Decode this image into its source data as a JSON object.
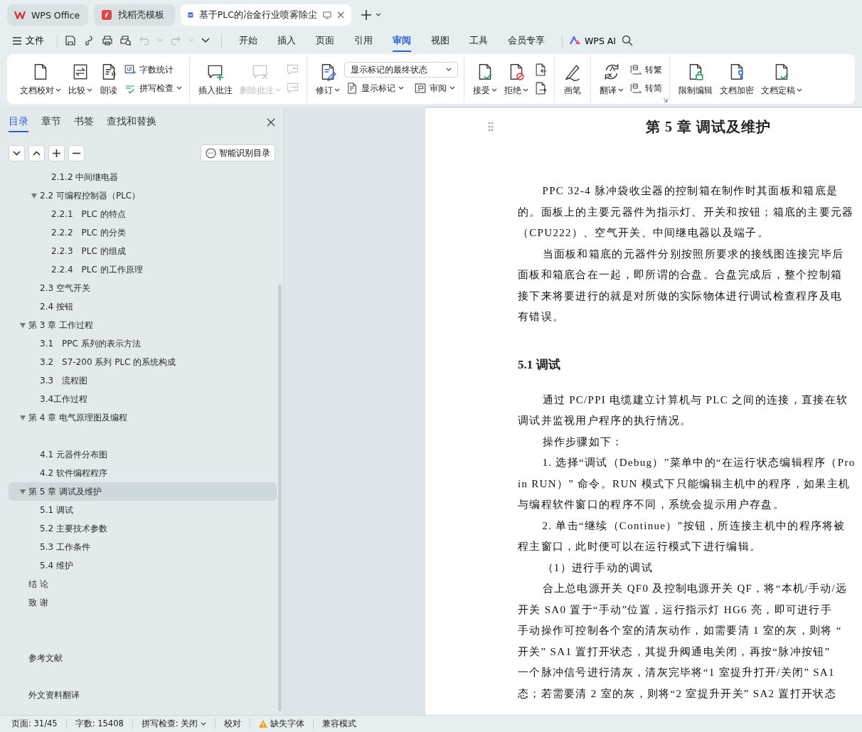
{
  "title_tabs": [
    {
      "label": "WPS Office",
      "selected": false,
      "kind": "home"
    },
    {
      "label": "找稻壳模板",
      "selected": false,
      "kind": "template"
    },
    {
      "label": "基于PLC的冶金行业喷雾除尘",
      "selected": true,
      "kind": "document"
    }
  ],
  "menu_bar": {
    "file": "文件",
    "tabs": [
      {
        "label": "开始",
        "selected": false
      },
      {
        "label": "插入",
        "selected": false
      },
      {
        "label": "页面",
        "selected": false
      },
      {
        "label": "引用",
        "selected": false
      },
      {
        "label": "审阅",
        "selected": true
      },
      {
        "label": "视图",
        "selected": false
      },
      {
        "label": "工具",
        "selected": false
      },
      {
        "label": "会员专享",
        "selected": false
      }
    ],
    "ai": "WPS AI"
  },
  "ribbon": {
    "groups": [
      {
        "items": [
          {
            "kind": "large",
            "label": "文档校对",
            "menu": true,
            "disabled": false
          },
          {
            "kind": "large",
            "label": "比较",
            "menu": true,
            "disabled": false
          },
          {
            "kind": "large",
            "label": "朗读",
            "menu": false,
            "disabled": false
          },
          {
            "kind": "stack",
            "items": [
              {
                "kind": "small",
                "label": "字数统计",
                "menu": false,
                "disabled": false
              },
              {
                "kind": "small",
                "label": "拼写检查",
                "menu": true,
                "disabled": false
              }
            ]
          }
        ]
      },
      {
        "items": [
          {
            "kind": "large",
            "label": "插入批注",
            "menu": false,
            "disabled": false
          },
          {
            "kind": "large",
            "label": "删除批注",
            "menu": true,
            "disabled": true
          },
          {
            "kind": "stack",
            "items": [
              {
                "kind": "icon",
                "disabled": true
              },
              {
                "kind": "icon",
                "disabled": true
              }
            ]
          }
        ]
      },
      {
        "items": [
          {
            "kind": "large",
            "label": "修订",
            "menu": true,
            "disabled": false
          },
          {
            "kind": "stack",
            "items": [
              {
                "kind": "select",
                "value": "显示标记的最终状态"
              },
              {
                "kind": "row",
                "items": [
                  {
                    "kind": "small",
                    "label": "显示标记",
                    "menu": true,
                    "disabled": false
                  },
                  {
                    "kind": "small",
                    "label": "审阅",
                    "menu": true,
                    "disabled": false
                  }
                ]
              }
            ]
          }
        ]
      },
      {
        "items": [
          {
            "kind": "large",
            "label": "接受",
            "menu": true,
            "disabled": false
          },
          {
            "kind": "large",
            "label": "拒绝",
            "menu": true,
            "disabled": false
          },
          {
            "kind": "stack",
            "items": [
              {
                "kind": "icon",
                "disabled": false
              },
              {
                "kind": "icon",
                "disabled": false
              }
            ]
          }
        ]
      },
      {
        "items": [
          {
            "kind": "large",
            "label": "画笔",
            "menu": false,
            "disabled": false
          }
        ]
      },
      {
        "items": [
          {
            "kind": "large",
            "label": "翻译",
            "menu": true,
            "disabled": false
          },
          {
            "kind": "stack",
            "items": [
              {
                "kind": "small",
                "label": "转繁",
                "menu": false,
                "disabled": false
              },
              {
                "kind": "small",
                "label": "转简",
                "menu": false,
                "disabled": false
              }
            ]
          }
        ]
      },
      {
        "items": [
          {
            "kind": "large",
            "label": "限制编辑",
            "menu": false,
            "disabled": false
          },
          {
            "kind": "large",
            "label": "文档加密",
            "menu": false,
            "disabled": false
          },
          {
            "kind": "large",
            "label": "文档定稿",
            "menu": true,
            "disabled": false
          }
        ]
      }
    ]
  },
  "sidebar": {
    "tabs": [
      {
        "label": "目录",
        "selected": true
      },
      {
        "label": "章节",
        "selected": false
      },
      {
        "label": "书签",
        "selected": false
      },
      {
        "label": "查找和替换",
        "selected": false
      }
    ],
    "smart_button": "智能识别目录",
    "tree": [
      {
        "children": [
          {
            "children": [
              {
                "label": "2.1.2 中间继电器",
                "selected": false
              }
            ]
          },
          {
            "label": "2.2 可编程控制器（PLC）",
            "selected": false,
            "expanded": true,
            "children": [
              {
                "label": "2.2.1　PLC 的特点",
                "selected": false
              },
              {
                "label": "2.2.2　PLC 的分类",
                "selected": false
              },
              {
                "label": "2.2.3　PLC 的组成",
                "selected": false
              },
              {
                "label": "2.2.4　PLC 的工作原理",
                "selected": false
              }
            ]
          },
          {
            "label": "2.3 空气开关",
            "selected": false
          },
          {
            "label": "2.4 按钮",
            "selected": false
          }
        ]
      },
      {
        "label": "第 3 章 工作过程",
        "selected": false,
        "expanded": true,
        "children": [
          {
            "label": "3.1　PPC 系列的表示方法",
            "selected": false
          },
          {
            "label": "3.2　S7-200 系列 PLC 的系统构成",
            "selected": false
          },
          {
            "label": "3.3　流程图",
            "selected": false
          },
          {
            "label": "3.4工作过程",
            "selected": false
          }
        ]
      },
      {
        "label": "第 4 章 电气原理图及编程",
        "selected": false,
        "expanded": true,
        "children": [
          {
            "kind": "blank"
          },
          {
            "label": "4.1 元器件分布图",
            "selected": false
          },
          {
            "label": "4.2 软件编程程序",
            "selected": false
          }
        ]
      },
      {
        "label": "第 5 章 调试及维护",
        "selected": true,
        "expanded": true,
        "children": [
          {
            "label": "5.1 调试",
            "selected": false
          },
          {
            "label": "5.2 主要技术参数",
            "selected": false
          },
          {
            "label": "5.3 工作条件",
            "selected": false
          },
          {
            "label": "5.4 维护",
            "selected": false
          }
        ]
      },
      {
        "label": "结 论",
        "selected": false
      },
      {
        "label": "致 谢",
        "selected": false
      },
      {
        "kind": "blank"
      },
      {
        "kind": "blank"
      },
      {
        "label": "参考文献",
        "selected": false
      },
      {
        "kind": "blank"
      },
      {
        "label": "外文资料翻译",
        "selected": false
      }
    ]
  },
  "document": [
    {
      "kind": "chapter_title",
      "text": "第 5 章  调试及维护"
    },
    {
      "kind": "body",
      "lines": [
        "PPC 32-4 脉冲袋收尘器的控制箱在制作时其面板和箱底是",
        "的。面板上的主要元器件为指示灯、开关和按钮；箱底的主要元器",
        "（CPU222）、空气开关、中间继电器以及端子。"
      ]
    },
    {
      "kind": "body",
      "lines": [
        "当面板和箱底的元器件分别按照所要求的接线图连接完毕后",
        "面板和箱底合在一起，即所谓的合盘。合盘完成后，整个控制箱",
        "接下来将要进行的就是对所做的实际物体进行调试检查程序及电",
        "有错误。"
      ]
    },
    {
      "kind": "heading",
      "text": "5.1  调试"
    },
    {
      "kind": "body",
      "lines": [
        "通过 PC/PPI 电缆建立计算机与 PLC 之间的连接，直接在软",
        "调试并监视用户程序的执行情况。"
      ]
    },
    {
      "kind": "body",
      "lines": [
        "操作步骤如下："
      ]
    },
    {
      "kind": "body",
      "lines": [
        "1. 选择“调试（Debug）”菜单中的“在运行状态编辑程序（Pro",
        "in RUN）” 命令。RUN 模式下只能编辑主机中的程序，如果主机",
        "与编程软件窗口的程序不同，系统会提示用户存盘。"
      ]
    },
    {
      "kind": "body",
      "lines": [
        "2. 单击“继续（Continue）”按钮，所连接主机中的程序将被",
        "程主窗口，此时便可以在运行模式下进行编辑。"
      ]
    },
    {
      "kind": "body",
      "lines": [
        "（1）进行手动的调试"
      ]
    },
    {
      "kind": "body",
      "lines": [
        "合上总电源开关 QF0 及控制电源开关 QF，将“本机/手动/远",
        "开关 SA0 置于“手动”位置，运行指示灯 HG6 亮，即可进行手",
        "手动操作可控制各个室的清灰动作，如需要清 1 室的灰，则将 “",
        "开关” SA1 置打开状态，其提升阀通电关闭，再按“脉冲按钮”",
        "一个脉冲信号进行清灰，清灰完毕将“1 室提升打开/关闭” SA1",
        "态；若需要清 2 室的灰，则将“2 室提升开关” SA2 置打开状态"
      ]
    }
  ],
  "status_bar": [
    {
      "kind": "text",
      "text": "页面: 31/45"
    },
    {
      "kind": "text",
      "text": "字数: 15408"
    },
    {
      "kind": "menu",
      "text": "拼写检查: 关闭"
    },
    {
      "kind": "text",
      "text": "校对"
    },
    {
      "kind": "warning",
      "text": "缺失字体"
    },
    {
      "kind": "text",
      "text": "兼容模式"
    }
  ]
}
